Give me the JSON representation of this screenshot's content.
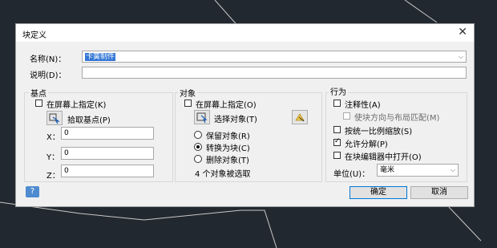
{
  "dialog": {
    "title": "块定义",
    "close_icon": "close-icon"
  },
  "name": {
    "label": "名称(N)：",
    "value": "卡簧制件"
  },
  "description": {
    "label": "说明(D)：",
    "value": ""
  },
  "base_point": {
    "group_title": "基点",
    "specify_on_screen": "在屏幕上指定(K)",
    "specify_checked": false,
    "pick_button": "拾取基点(P)",
    "x_label": "X：",
    "x_value": "0",
    "y_label": "Y：",
    "y_value": "0",
    "z_label": "Z：",
    "z_value": "0"
  },
  "objects": {
    "group_title": "对象",
    "specify_on_screen": "在屏幕上指定(O)",
    "specify_checked": false,
    "select_button": "选择对象(T)",
    "retain": "保留对象(R)",
    "convert": "转换为块(C)",
    "delete": "删除对象(T)",
    "selected_option": "convert",
    "count_text": "4 个对象被选取"
  },
  "behavior": {
    "group_title": "行为",
    "annotative": "注释性(A)",
    "annotative_checked": false,
    "match_orientation": "使块方向与布局匹配(M)",
    "match_checked": false,
    "scale_uniformly": "按统一比例缩放(S)",
    "scale_checked": false,
    "allow_explode": "允许分解(P)",
    "explode_checked": true,
    "open_in_editor": "在块编辑器中打开(O)",
    "open_checked": false,
    "unit_label": "单位(U)：",
    "unit_value": "毫米"
  },
  "buttons": {
    "help": "?",
    "ok": "确定",
    "cancel": "取消"
  },
  "colors": {
    "background": "#212830",
    "dialog": "#f0f0f0",
    "selection": "#3276d6",
    "help_button": "#4f8bd0"
  }
}
